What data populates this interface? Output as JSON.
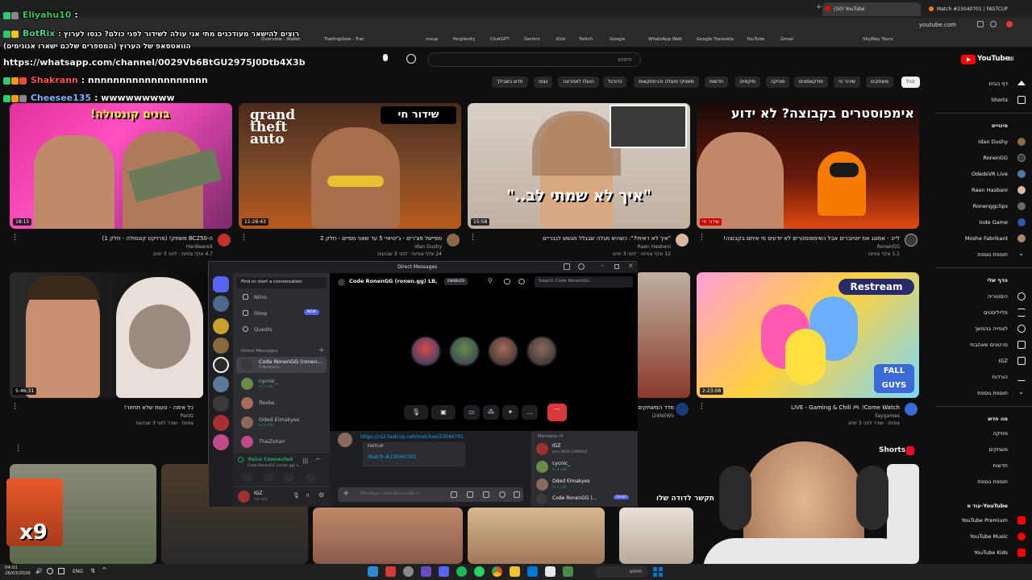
{
  "browser": {
    "tabs": [
      {
        "label": "(50) YouTube"
      },
      {
        "label": "Match #23040701 | FASTCUP"
      }
    ],
    "url": "youtube.com",
    "bookmarks": [
      "Overview - Wallet",
      "TradingView - Trac",
      "msup",
      "Perplexity",
      "ChatGPT",
      "Gemini",
      "Kick",
      "Twitch",
      "Google",
      "WhatsApp Web",
      "Google Translate",
      "YouTube",
      "Gmail",
      "SkyWay Tours"
    ]
  },
  "chat_overlay": {
    "lines": [
      {
        "user": "Eliyahu10",
        "text": ":",
        "color": "#34c759"
      },
      {
        "user": "BotRix",
        "text": ": רוצים להישאר מעודכנים מתי אני עולה לשידור לפני כולם? כנסו לערוץ",
        "color": "#3ecf8e"
      },
      {
        "user": "",
        "text": "הוואטסאפ של הערוץ (המספרים שלכם ישארו אנונימים)",
        "color": "#ffffff"
      },
      {
        "user": "",
        "text": "https://whatsapp.com/channel/0029Vb6BtGU2975J0Dtb4X3b",
        "color": "#ffffff"
      },
      {
        "user": "Shakrann",
        "text": ": nnnnnnnnnnnnnnnnnnn",
        "color": "#ff4d4d"
      },
      {
        "user": "Cheesee135",
        "text": ": wwwwwwwww",
        "color": "#7fb4ff"
      }
    ]
  },
  "youtube": {
    "search_placeholder": "חיפוש",
    "logo": "YouTube",
    "chips": [
      "הכל",
      "משחקים",
      "שידור חי",
      "פודקאסטים",
      "מוזיקה",
      "מיקסים",
      "חדשות",
      "משחקי פעולה והרפתקאות",
      "כדורגל",
      "הועלו לאחרונה",
      "נצפו",
      "חדש בשבילך"
    ],
    "videos": [
      {
        "title": "ה-BC250 משחק! (פרויקט קונסולה - חלק 1)",
        "channel": "HardwareX",
        "meta": "4.7 אלף צפיות · לפני 3 ימים",
        "duration": "18:15",
        "overlay": "בונים קונסולה!"
      },
      {
        "title": "ספיישל פצ'רים - ג'יטיאיי 5 עד שאני מסיים - חלק 2",
        "channel": "Idan Dushy",
        "meta": "24 אלף צפיות · לפני 3 שבועות",
        "duration": "11:26:43",
        "overlay": "שידור חי"
      },
      {
        "title": "\"איך לא ראיתי?\": כשהיא מגלה שבגלל מגשש לגבריים",
        "channel": "Raen Hasbani",
        "meta": "12 אלף צפיות · לפני 3 ימים",
        "duration": "15:58",
        "overlay": "\"איך לא שמתי לב..\""
      },
      {
        "title": "לייב - אמונג אס יוטיוברים אבל האימפוסטרים לא יודעים מי איתם בקבוצה!",
        "channel": "RonenGG",
        "meta": "1.1 אלף צפיות",
        "duration": "שידור חי",
        "overlay": "אימפוסטרים בקבוצה? לא ידוע"
      },
      {
        "title": "כל אימה - טעות שלא תחזור!",
        "channel": "Pantz",
        "meta": "צפיות · שודר לפני 3 שבועות",
        "duration": "5:46:31",
        "overlay": ""
      },
      {
        "title": "מדד המשחקים",
        "channel": "i24NEWS",
        "meta": "צפיות · שודר לפני 3 שבועות",
        "duration": "",
        "overlay": ""
      },
      {
        "title": "LIVE - Gaming & Chill 🎮 !Come Watch",
        "channel": "llaygames",
        "meta": "צפיות · שודר לפני 3 ימים",
        "duration": "2:23:08",
        "overlay": "Restream"
      }
    ],
    "shorts_label": "Shorts",
    "sidebar": {
      "home": "דף הבית",
      "shorts": "Shorts",
      "subscriptions_head": "מינויים",
      "subs": [
        "Idan Dushy",
        "RonenGG",
        "OdedsVR Live",
        "Raen Hasbani",
        "Ronenggclips",
        "Inde Game",
        "Moshe Fabrikant"
      ],
      "show_more": "תוספת נוספת",
      "you_head": "הדף שלי",
      "you": [
        "היסטוריה",
        "פלייליסטים",
        "לצפייה בהמשך",
        "סרטונים שאהבתי",
        "IGZ",
        "הורדות"
      ],
      "show_more2": "תוספת נוספת",
      "new_head": "מה חדש",
      "new": [
        "מוזיקה",
        "משחקים",
        "חדשות",
        "תוספת נוספת"
      ],
      "more_head": "עוד מ-YouTube",
      "more": [
        "YouTube Premium",
        "YouTube Music",
        "YouTube Kids"
      ]
    }
  },
  "discord": {
    "window_title": "Direct Messages",
    "find_placeholder": "Find or start a conversation",
    "nav": [
      "Nitro",
      "Shop",
      "Quests"
    ],
    "shop_badge": "NEW",
    "dm_header": "Direct Messages",
    "dms": [
      {
        "name": "Code RonenGG (ronen...",
        "sub": "6 Members"
      },
      {
        "name": "cycnic_",
        "sub": "In a call"
      },
      {
        "name": "flexbs",
        "sub": ""
      },
      {
        "name": "Oded Elmakyes",
        "sub": "In a call"
      },
      {
        "name": "TheZohan",
        "sub": ""
      }
    ],
    "voice_status": "Voice Connected",
    "voice_channel": "Code RonenGG (ronen.gg) L...",
    "user_name": "IGZ",
    "user_status": "ג'ייני קלי",
    "channel_title": "Code RonenGG (ronen.gg) LB,",
    "enabled_badge": "ENABLED",
    "search_placeholder": "Search Code RonenGG...",
    "message_link": "https://cs2.fastcup.net/matches/23040701",
    "embed_provider": "FASTCUP",
    "embed_title": "Match #23040701",
    "message_placeholder": "Message Code RonenGG (r...",
    "members_head": "Members—5",
    "members": [
      {
        "name": "IGZ",
        "sub": "בזמן: KICK.COM/IGZ"
      },
      {
        "name": "cycnic_",
        "sub": "In a call"
      },
      {
        "name": "Oded Elmakyes",
        "sub": "In a call"
      },
      {
        "name": "Code RonenGG (...",
        "sub": "DROP"
      }
    ]
  },
  "shorts_titles": [
    "תקשר לדודה שלו"
  ],
  "overlay_badge": "x9",
  "taskbar": {
    "time": "04:01",
    "date": "26/03/2026",
    "lang": "ENG",
    "search": "חיפוש"
  }
}
